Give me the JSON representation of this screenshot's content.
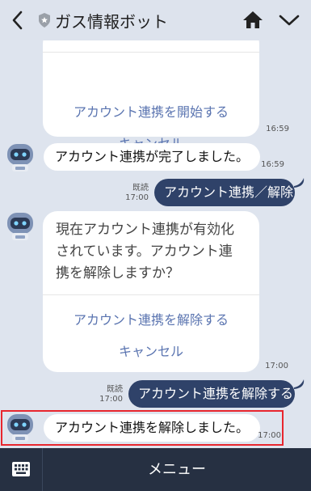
{
  "header": {
    "title": "ガス情報ボット"
  },
  "messages": {
    "card1": {
      "action_start": "アカウント連携を開始する",
      "cancel": "キャンセル",
      "time": "16:59"
    },
    "msg_complete": {
      "text": "アカウント連携が完了しました。",
      "time": "16:59"
    },
    "sent1": {
      "text": "アカウント連携／解除",
      "read": "既読",
      "time": "17:00"
    },
    "card2": {
      "line1": "現在アカウント連携が有効化",
      "line2": "されています。アカウント連",
      "line3": "携を解除しますか？",
      "action_unlink": "アカウント連携を解除する",
      "cancel": "キャンセル",
      "time": "17:00"
    },
    "sent2": {
      "text": "アカウント連携を解除する",
      "read": "既読",
      "time": "17:00"
    },
    "msg_unlinked": {
      "text": "アカウント連携を解除しました。",
      "time": "17:00"
    }
  },
  "footer": {
    "menu_label": "メニュー"
  },
  "icons": {
    "back": "back-chevron-icon",
    "shield": "shield-icon",
    "home": "home-icon",
    "expand": "chevron-down-icon",
    "keyboard": "keyboard-icon",
    "bot": "bot-avatar-icon"
  },
  "colors": {
    "sent_bubble": "#2f4269",
    "highlight": "#e8262e",
    "link": "#5a74b0",
    "bottom_bar": "#263042"
  }
}
